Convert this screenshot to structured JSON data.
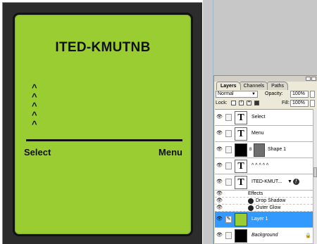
{
  "canvas": {
    "title": "ITED-KMUTNB",
    "carets": [
      "^",
      "^",
      "^",
      "^",
      "^"
    ],
    "softkey_left": "Select",
    "softkey_right": "Menu",
    "lcd_color": "#9acd32"
  },
  "layers_panel": {
    "tabs": [
      "Layers",
      "Channels",
      "Paths"
    ],
    "blend_mode": "Normal",
    "opacity_label": "Opacity:",
    "opacity_value": "100%",
    "lock_label": "Lock:",
    "fill_label": "Fill:",
    "fill_value": "100%",
    "layers": [
      {
        "name": "Select",
        "type": "text"
      },
      {
        "name": "Menu",
        "type": "text"
      },
      {
        "name": "Shape 1",
        "type": "shape"
      },
      {
        "name": "^ ^ ^ ^ ^",
        "type": "text"
      },
      {
        "name": "ITED-KMUT...",
        "type": "text",
        "has_effects": true
      },
      {
        "name": "Layer 1",
        "type": "pixel",
        "selected": true
      },
      {
        "name": "Background",
        "type": "background"
      }
    ],
    "effects_label": "Effects",
    "effects": [
      "Drop Shadow",
      "Outer Glow"
    ],
    "selected_color": "#3399ff"
  }
}
